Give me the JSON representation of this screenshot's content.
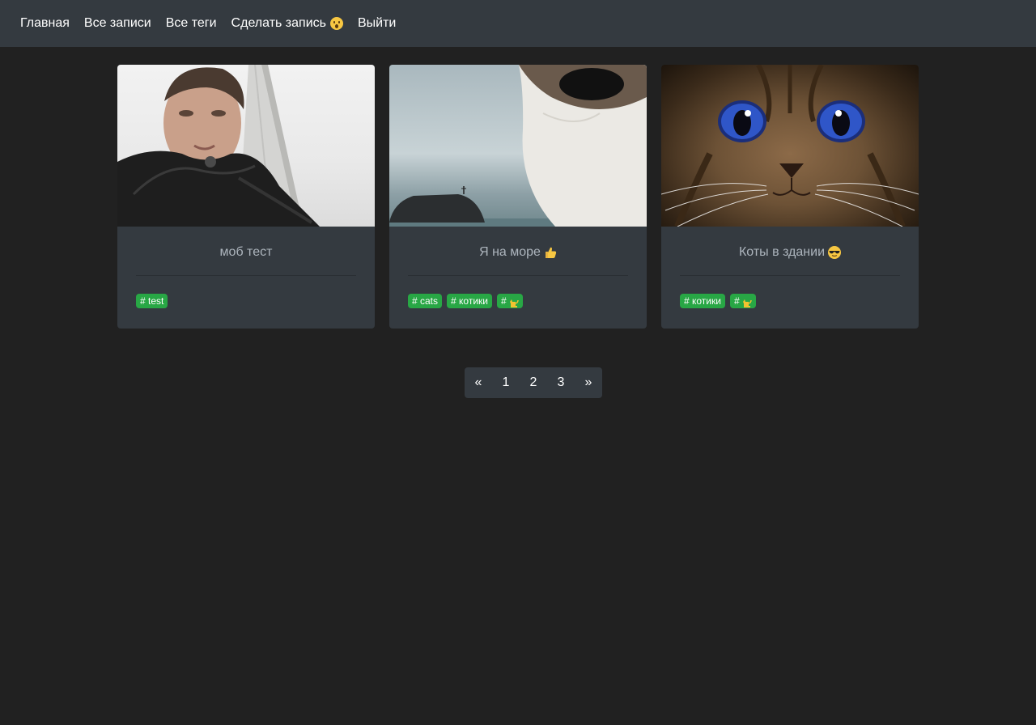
{
  "nav": {
    "items": [
      {
        "label": "Главная"
      },
      {
        "label": "Все записи"
      },
      {
        "label": "Все теги"
      },
      {
        "label": "Сделать запись",
        "icon": "hushed-face-emoji-icon"
      },
      {
        "label": "Выйти"
      }
    ]
  },
  "cards": [
    {
      "title": "моб тест",
      "image": "man-selfie-with-tower-photo",
      "tags": [
        {
          "label": "# test"
        }
      ]
    },
    {
      "title": "Я на море",
      "title_icon": "thumbs-up-emoji-icon",
      "image": "cat-at-sea-photo",
      "tags": [
        {
          "label": "# cats"
        },
        {
          "label": "# котики"
        },
        {
          "label": "#",
          "icon": "cat-emoji-icon"
        }
      ]
    },
    {
      "title": "Коты в здании",
      "title_icon": "sunglasses-face-emoji-icon",
      "image": "blue-eyed-cat-face-photo",
      "tags": [
        {
          "label": "# котики"
        },
        {
          "label": "#",
          "icon": "cat-emoji-icon"
        }
      ]
    }
  ],
  "pagination": {
    "prev": "«",
    "pages": [
      "1",
      "2",
      "3"
    ],
    "next": "»"
  },
  "colors": {
    "page_bg": "#212121",
    "navbar_bg": "#343a40",
    "card_bg": "#343a40",
    "tag_bg": "#28a745",
    "title_text": "#adb5bd"
  }
}
